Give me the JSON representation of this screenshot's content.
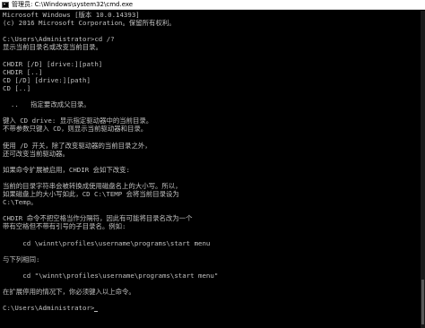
{
  "window": {
    "title": "管理员: C:\\Windows\\system32\\cmd.exe"
  },
  "console": {
    "lines": [
      "Microsoft Windows [版本 10.0.14393]",
      "(c) 2016 Microsoft Corporation。保留所有权利。",
      "",
      "C:\\Users\\Administrator>cd /?",
      "显示当前目录名或改变当前目录。",
      "",
      "CHDIR [/D] [drive:][path]",
      "CHDIR [..]",
      "CD [/D] [drive:][path]",
      "CD [..]",
      "",
      "  ..   指定要改成父目录。",
      "",
      "键入 CD drive: 显示指定驱动器中的当前目录。",
      "不带参数只键入 CD，则显示当前驱动器和目录。",
      "",
      "使用 /D 开关，除了改变驱动器的当前目录之外，",
      "还可改变当前驱动器。",
      "",
      "如果命令扩展被启用，CHDIR 会如下改变:",
      "",
      "当前的目录字符串会被转换成使用磁盘名上的大小写。所以，",
      "如果磁盘上的大小写如此，CD C:\\TEMP 会将当前目录设为",
      "C:\\Temp。",
      "",
      "CHDIR 命令不把空格当作分隔符，因此有可能将目录名改为一个",
      "带有空格但不带有引号的子目录名。例如:",
      "",
      "     cd \\winnt\\profiles\\username\\programs\\start menu",
      "",
      "与下列相同:",
      "",
      "     cd \"\\winnt\\profiles\\username\\programs\\start menu\"",
      "",
      "在扩展停用的情况下，你必须键入以上命令。",
      "",
      "C:\\Users\\Administrator>"
    ]
  },
  "colors": {
    "background": "#000000",
    "text": "#c0c0c0",
    "titlebar": "#ffffff"
  },
  "icons": {
    "app": "cmd-console-icon"
  }
}
